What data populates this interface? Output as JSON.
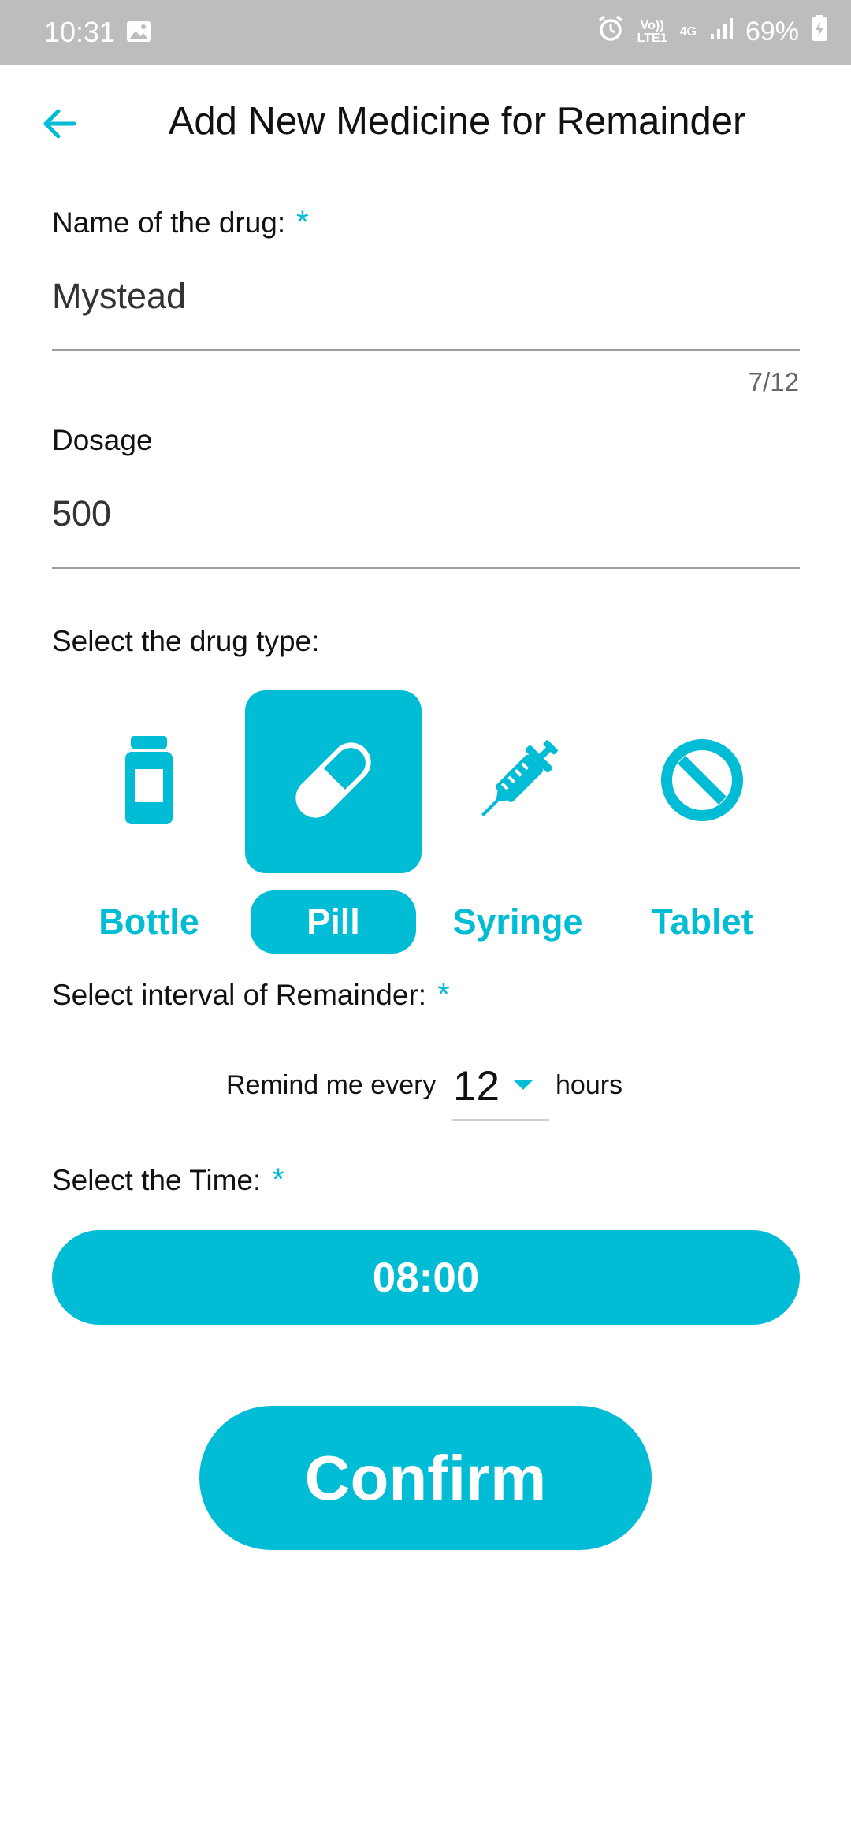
{
  "status_bar": {
    "time": "10:31",
    "gallery_icon": "image-icon",
    "alarm_icon": "alarm-icon",
    "volte_top": "Vo))",
    "volte_bottom": "LTE1",
    "network": "4G",
    "signal_icon": "signal-icon",
    "battery": "69%",
    "battery_icon": "battery-charging-icon"
  },
  "app_bar": {
    "back_icon": "arrow-back-icon",
    "title": "Add New Medicine for Remainder"
  },
  "drug_name": {
    "label": "Name of the drug:",
    "required_mark": "*",
    "value": "Mystead",
    "counter": "7/12"
  },
  "dosage": {
    "label": "Dosage",
    "value": "500"
  },
  "drug_type": {
    "label": "Select the drug type:",
    "selected": "Pill",
    "options": [
      {
        "label": "Bottle",
        "icon": "bottle-icon"
      },
      {
        "label": "Pill",
        "icon": "pill-icon"
      },
      {
        "label": "Syringe",
        "icon": "syringe-icon"
      },
      {
        "label": "Tablet",
        "icon": "tablet-icon"
      }
    ]
  },
  "interval": {
    "label": "Select interval of Remainder:",
    "required_mark": "*",
    "prefix": "Remind me every",
    "value": "12",
    "suffix": "hours"
  },
  "time": {
    "label": "Select the Time:",
    "required_mark": "*",
    "value": "08:00"
  },
  "confirm_label": "Confirm",
  "colors": {
    "accent": "#00bcd4",
    "status_bar": "#bdbdbd"
  }
}
